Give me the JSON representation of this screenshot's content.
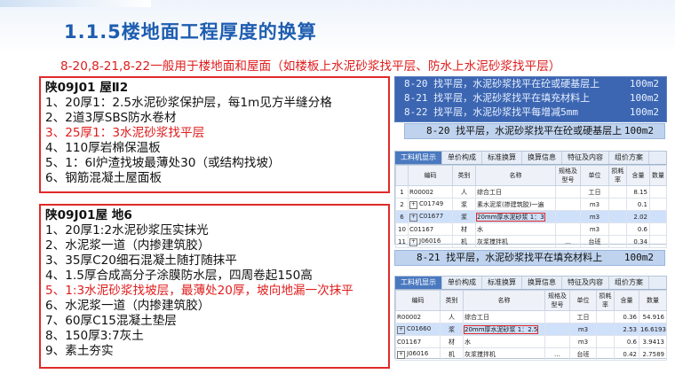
{
  "title": "1.1.5楼地面工程厚度的换算",
  "subtitle": "8-20,8-21,8-22一般用于楼地面和屋面（如楼板上水泥砂浆找平层、防水上水泥砂浆找平层）",
  "box1": {
    "heading": "陕09J01  屋Ⅱ2",
    "lines": [
      {
        "text": "1、20厚1：2.5水泥砂浆保护层，每1m见方半缝分格",
        "red": false
      },
      {
        "text": "2、2道3厚SBS防水卷材",
        "red": false
      },
      {
        "text": "3、25厚1：3水泥砂浆找平层",
        "red": true
      },
      {
        "text": "4、110厚岩棉保温板",
        "red": false
      },
      {
        "text": "5、1：6l炉渣找坡最薄处30（或结构找坡）",
        "red": false
      },
      {
        "text": "6、钢筋混凝土屋面板",
        "red": false
      }
    ]
  },
  "box2": {
    "heading": "陕09J01屋  地6",
    "lines": [
      {
        "text": "1、20厚1:2水泥砂浆压实抹光",
        "red": false
      },
      {
        "text": "2、水泥浆一道（内掺建筑胶）",
        "red": false
      },
      {
        "text": "3、35厚C20细石混凝土随打随抹平",
        "red": false
      },
      {
        "text": "4、1.5厚合成高分子涂膜防水层，四周卷起150高",
        "red": false
      },
      {
        "text": "5、1:3水泥砂浆找坡层，最薄处20厚，坡向地漏一次抹平",
        "red": true
      },
      {
        "text": "6、水泥浆一道（内掺建筑胶）",
        "red": false
      },
      {
        "text": "7、60厚C15混凝土垫层",
        "red": false
      },
      {
        "text": "8、150厚3:7灰土",
        "red": false
      },
      {
        "text": "9、素土夯实",
        "red": false
      }
    ]
  },
  "quota_rows": [
    {
      "text": "8-20   找平层，水泥砂浆找平在砼或硬基层上",
      "unit": "100m2"
    },
    {
      "text": "8-21   找平层，水泥砂浆找平在填充材料上",
      "unit": "100m2"
    },
    {
      "text": "8-22   找平层，水泥砂浆找平每增减5mm",
      "unit": "100m2"
    }
  ],
  "strip1": {
    "text": "8-20   找平层，水泥砂浆找平在砼或硬基层上",
    "unit": "100m2"
  },
  "strip2": {
    "text": "8-21   找平层，水泥砂浆找平在填充材料上",
    "unit": "100m2"
  },
  "tabs": [
    "工料机显示",
    "单价构成",
    "标准换算",
    "换算信息",
    "特征及内容",
    "组价方案"
  ],
  "headers": [
    "编码",
    "类别",
    "名称",
    "规格及型号",
    "单位",
    "损耗率",
    "含量",
    "数量"
  ],
  "grid1": [
    {
      "n": "1",
      "code": "R00002",
      "type": "人",
      "name": "综合工日",
      "spec": "",
      "unit": "工日",
      "amt": "8.15",
      "qty": "",
      "sel": false,
      "hl": false,
      "plus": false
    },
    {
      "n": "2",
      "code": "C01749",
      "type": "浆",
      "name": "素水泥浆(掺建筑胶)一遍",
      "spec": "",
      "unit": "m3",
      "amt": "0.1",
      "qty": "",
      "sel": false,
      "hl": false,
      "plus": true
    },
    {
      "n": "6",
      "code": "C01677",
      "type": "浆",
      "name": "20mm厚水泥砂浆 1：3",
      "spec": "",
      "unit": "m3",
      "amt": "2.02",
      "qty": "",
      "sel": true,
      "hl": true,
      "plus": true
    },
    {
      "n": "10",
      "code": "C01167",
      "type": "材",
      "name": "水",
      "spec": "",
      "unit": "m3",
      "amt": "0.6",
      "qty": "",
      "sel": false,
      "hl": false,
      "plus": false
    },
    {
      "n": "11",
      "code": "J06016",
      "type": "机",
      "name": "灰浆搅拌机",
      "spec": "…",
      "unit": "台班",
      "amt": "0.34",
      "qty": "",
      "sel": false,
      "hl": false,
      "plus": true
    }
  ],
  "grid2": [
    {
      "n": "",
      "code": "R00002",
      "type": "人",
      "name": "综合工日",
      "spec": "",
      "unit": "工日",
      "amt": "0.36",
      "qty": "54.916",
      "sel": false,
      "hl": false,
      "plus": false
    },
    {
      "n": "",
      "code": "C01660",
      "type": "浆",
      "name": "20mm厚水泥砂浆 1：2.5",
      "spec": "",
      "unit": "m3",
      "amt": "2.53",
      "qty": "16.6193",
      "sel": true,
      "hl": true,
      "plus": true
    },
    {
      "n": "",
      "code": "C01167",
      "type": "材",
      "name": "水",
      "spec": "",
      "unit": "m3",
      "amt": "0.6",
      "qty": "3.9413",
      "sel": false,
      "hl": false,
      "plus": false
    },
    {
      "n": "",
      "code": "J06016",
      "type": "机",
      "name": "灰浆搅拌机",
      "spec": "…",
      "unit": "台班",
      "amt": "0.42",
      "qty": "2.7589",
      "sel": false,
      "hl": false,
      "plus": true
    }
  ]
}
